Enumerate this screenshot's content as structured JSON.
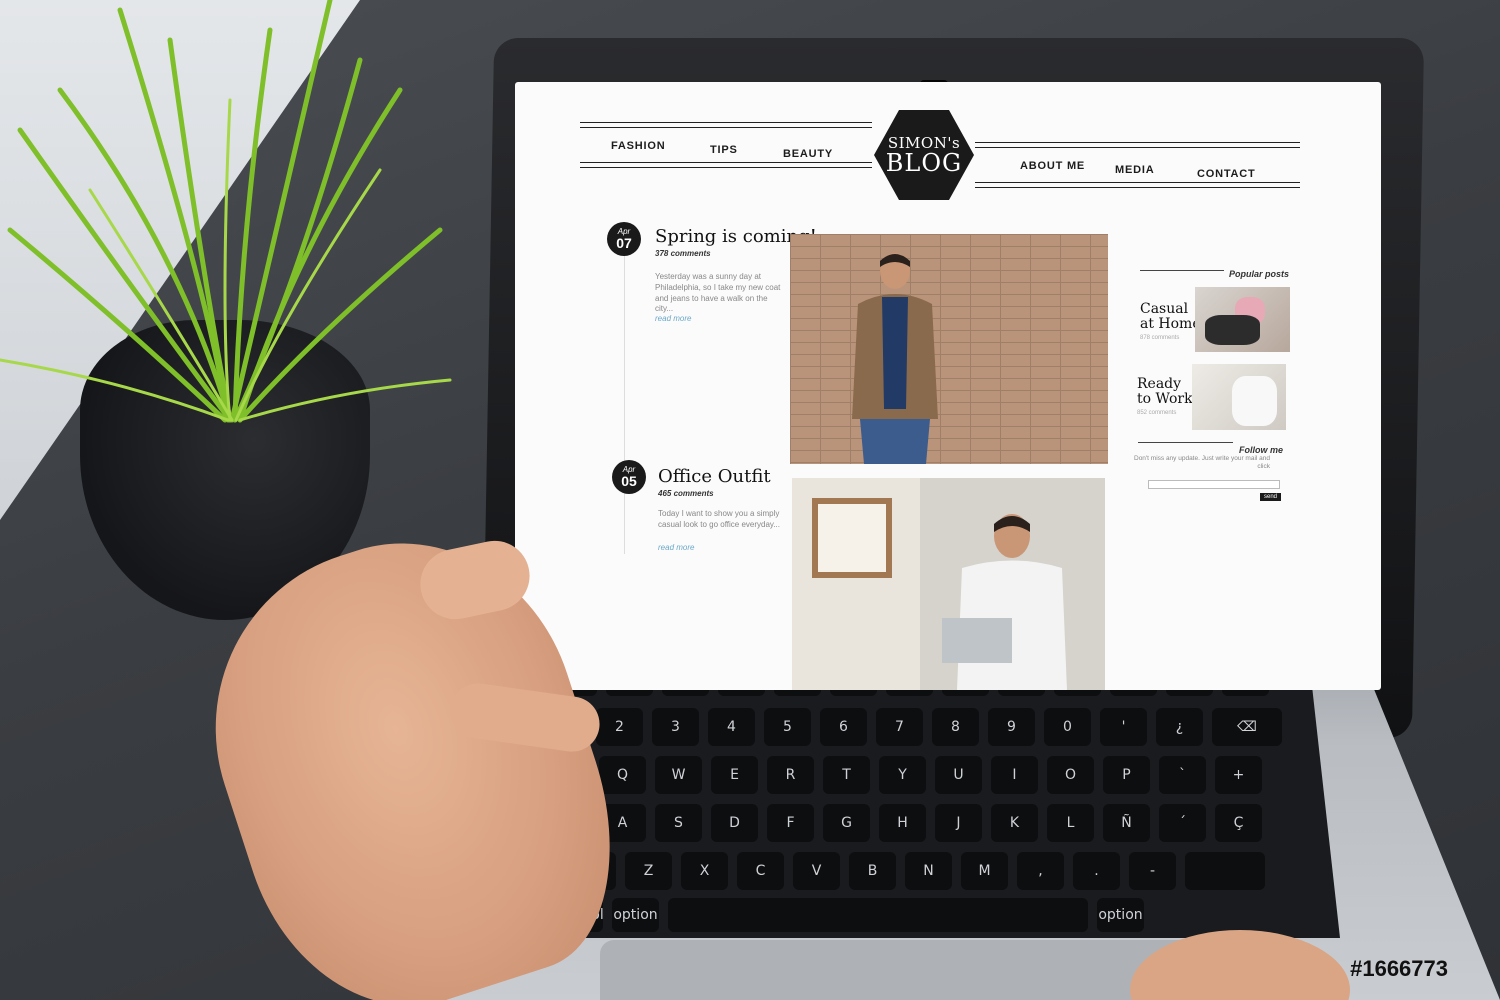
{
  "blog": {
    "nav_left": [
      "FASHION",
      "TIPS",
      "BEAUTY"
    ],
    "nav_right": [
      "ABOUT ME",
      "MEDIA",
      "CONTACT"
    ],
    "logo": {
      "line1": "SIMON's",
      "line2": "BLOG"
    }
  },
  "posts": [
    {
      "month": "Apr",
      "day": "07",
      "title": "Spring is coming!",
      "comments": "378 comments",
      "excerpt": "Yesterday was a sunny day at Philadelphia, so I take my new coat and jeans to have a walk on the city...",
      "read_more": "read more"
    },
    {
      "month": "Apr",
      "day": "05",
      "title": "Office Outfit",
      "comments": "465 comments",
      "excerpt": "Today I want to show you a simply casual look to go office everyday...",
      "read_more": "read more"
    }
  ],
  "sidebar": {
    "popular_heading": "Popular posts",
    "popular": [
      {
        "title_line1": "Casual",
        "title_line2": "at Home",
        "comments": "878 comments"
      },
      {
        "title_line1": "Ready",
        "title_line2": "to Work",
        "comments": "852 comments"
      }
    ],
    "follow_heading": "Follow me",
    "follow_text": "Don't miss any update. Just write your mail and click",
    "send_label": "send"
  },
  "image_id": "#1666773"
}
